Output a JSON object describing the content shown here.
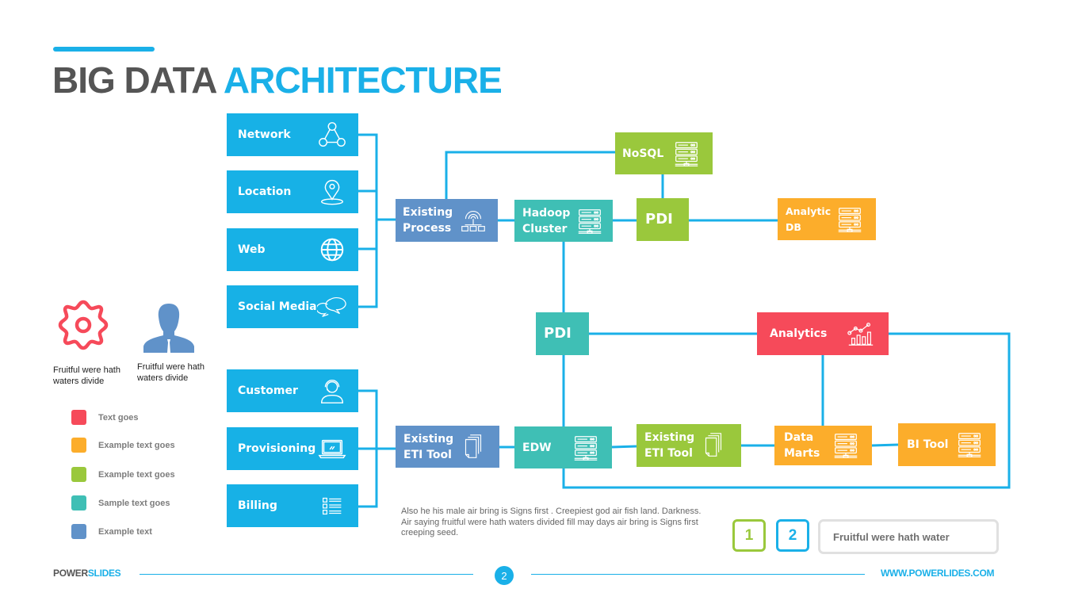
{
  "title": {
    "part1": "BIG DATA",
    "part2": "ARCHITECTURE"
  },
  "colors": {
    "blue": "#17b1e6",
    "steel": "#6092c9",
    "teal": "#3fbfb5",
    "green": "#9ac83c",
    "orange": "#fcad2b",
    "red": "#f64a5a",
    "connector": "#1ab0e8"
  },
  "sources_top": [
    {
      "label": "Network",
      "icon": "network-icon"
    },
    {
      "label": "Location",
      "icon": "location-pin-icon"
    },
    {
      "label": "Web",
      "icon": "globe-icon"
    },
    {
      "label": "Social Media",
      "icon": "chat-bubbles-icon"
    }
  ],
  "sources_bottom": [
    {
      "label": "Customer",
      "icon": "headset-user-icon"
    },
    {
      "label": "Provisioning",
      "icon": "laptop-icon"
    },
    {
      "label": "Billing",
      "icon": "checklist-icon"
    }
  ],
  "nodes": {
    "existing_process": {
      "label_line1": "Existing",
      "label_line2": "Process",
      "icon": "gear-network-icon"
    },
    "hadoop_cluster": {
      "label_line1": "Hadoop",
      "label_line2": "Cluster",
      "icon": "server-icon"
    },
    "nosql": {
      "label": "NoSQL",
      "icon": "server-icon"
    },
    "pdi_top": {
      "label": "PDI"
    },
    "analytic_db": {
      "label_line1": "Analytic",
      "label_line2": "DB",
      "icon": "server-icon"
    },
    "pdi_middle": {
      "label": "PDI"
    },
    "analytics": {
      "label": "Analytics",
      "icon": "chart-trend-icon"
    },
    "existing_eti_1": {
      "label_line1": "Existing",
      "label_line2": "ETI Tool",
      "icon": "documents-icon"
    },
    "edw": {
      "label": "EDW",
      "icon": "server-icon"
    },
    "existing_eti_2": {
      "label_line1": "Existing",
      "label_line2": "ETI Tool",
      "icon": "documents-icon"
    },
    "data_marts": {
      "label_line1": "Data",
      "label_line2": "Marts",
      "icon": "server-icon"
    },
    "bi_tool": {
      "label": "BI Tool",
      "icon": "server-icon"
    }
  },
  "side_icons": [
    {
      "icon": "gear-icon",
      "caption_line1": "Fruitful were hath",
      "caption_line2": "waters divide"
    },
    {
      "icon": "person-icon",
      "caption_line1": "Fruitful were hath",
      "caption_line2": "waters divide"
    }
  ],
  "legend": [
    {
      "color": "#f64a5a",
      "text": "Text goes"
    },
    {
      "color": "#fcad2b",
      "text": "Example text goes"
    },
    {
      "color": "#9ac83c",
      "text": "Example text goes"
    },
    {
      "color": "#3fbfb5",
      "text": "Sample text goes"
    },
    {
      "color": "#6092c9",
      "text": "Example text"
    }
  ],
  "paragraph": "Also he his male air bring is Signs first . Creepiest god air fish land. Darkness. Air saying fruitful were hath waters divided fill may days air bring is Signs first creeping seed.",
  "steps": [
    {
      "number": "1",
      "color": "#9ac83c"
    },
    {
      "number": "2",
      "color": "#1ab0e8"
    }
  ],
  "step_text": "Fruitful were hath water",
  "footer": {
    "brand_part1": "POWER",
    "brand_part2": "SLIDES",
    "page_number": "2",
    "url": "WWW.POWERLIDES.COM"
  }
}
